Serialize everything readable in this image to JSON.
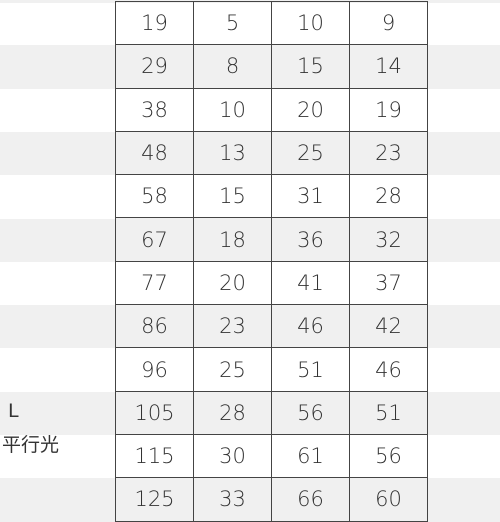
{
  "side_labels": {
    "size": "L",
    "note": "平行光"
  },
  "rows": [
    [
      "19",
      "5",
      "10",
      "9"
    ],
    [
      "29",
      "8",
      "15",
      "14"
    ],
    [
      "38",
      "10",
      "20",
      "19"
    ],
    [
      "48",
      "13",
      "25",
      "23"
    ],
    [
      "58",
      "15",
      "31",
      "28"
    ],
    [
      "67",
      "18",
      "36",
      "32"
    ],
    [
      "77",
      "20",
      "41",
      "37"
    ],
    [
      "86",
      "23",
      "46",
      "42"
    ],
    [
      "96",
      "25",
      "51",
      "46"
    ],
    [
      "105",
      "28",
      "56",
      "51"
    ],
    [
      "115",
      "30",
      "61",
      "56"
    ],
    [
      "125",
      "33",
      "66",
      "60"
    ]
  ]
}
